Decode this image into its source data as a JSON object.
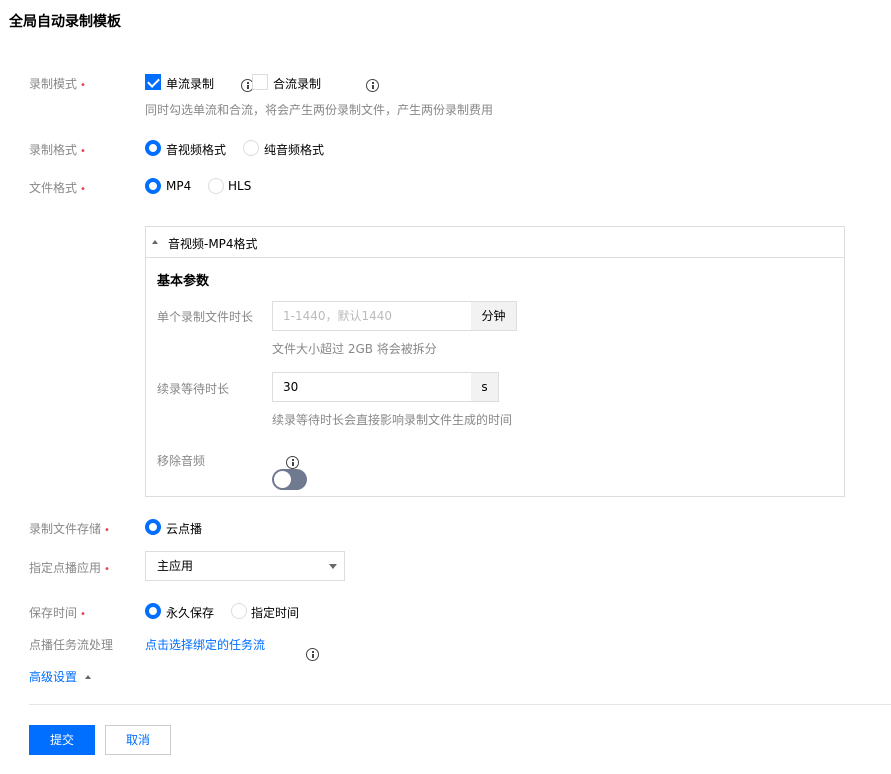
{
  "title": "全局自动录制模板",
  "record_mode": {
    "label": "录制模式",
    "required_mark": "•",
    "options": [
      {
        "label": "单流录制",
        "checked": true
      },
      {
        "label": "合流录制",
        "checked": false
      }
    ],
    "hint": "同时勾选单流和合流，将会产生两份录制文件，产生两份录制费用"
  },
  "record_format": {
    "label": "录制格式",
    "required_mark": "•",
    "options": [
      {
        "label": "音视频格式",
        "checked": true
      },
      {
        "label": "纯音频格式",
        "checked": false
      }
    ]
  },
  "file_format": {
    "label": "文件格式",
    "required_mark": "•",
    "options": [
      {
        "label": "MP4",
        "checked": true
      },
      {
        "label": "HLS",
        "checked": false
      }
    ]
  },
  "panel": {
    "header": "音视频-MP4格式",
    "section_title": "基本参数",
    "duration": {
      "label": "单个录制文件时长",
      "placeholder": "1-1440，默认1440",
      "unit": "分钟",
      "hint": "文件大小超过 2GB 将会被拆分"
    },
    "resume_wait": {
      "label": "续录等待时长",
      "value": "30",
      "unit": "s",
      "hint": "续录等待时长会直接影响录制文件生成的时间"
    },
    "remove_audio": {
      "label": "移除音频",
      "enabled": false
    }
  },
  "storage": {
    "label": "录制文件存储",
    "required_mark": "•",
    "option": {
      "label": "云点播",
      "checked": true
    }
  },
  "vod_app": {
    "label": "指定点播应用",
    "required_mark": "•",
    "selected": "主应用"
  },
  "retention": {
    "label": "保存时间",
    "required_mark": "•",
    "options": [
      {
        "label": "永久保存",
        "checked": true
      },
      {
        "label": "指定时间",
        "checked": false
      }
    ]
  },
  "task_flow": {
    "label": "点播任务流处理",
    "link": "点击选择绑定的任务流"
  },
  "advanced": {
    "label": "高级设置"
  },
  "buttons": {
    "submit": "提交",
    "cancel": "取消"
  },
  "colors": {
    "accent": "#006eff",
    "required": "#e54545",
    "toggle_off": "#6f7a91"
  }
}
